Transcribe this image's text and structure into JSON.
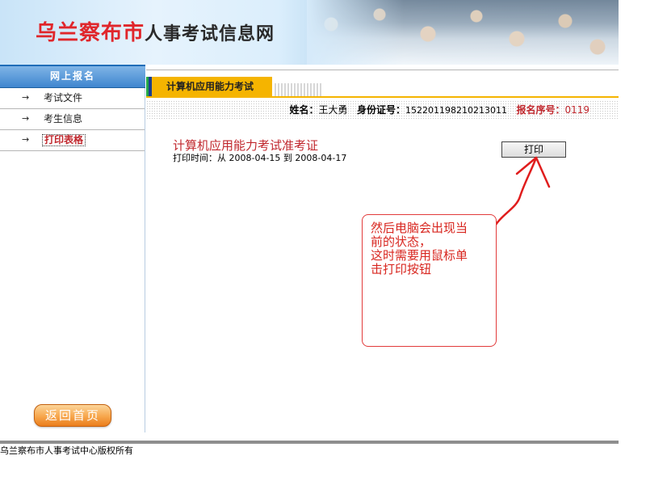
{
  "banner": {
    "city": "乌兰察布市",
    "title_rest": "人事考试信息网"
  },
  "sidebar": {
    "header": "网上报名",
    "items": [
      {
        "arrow": "→",
        "label": "考试文件"
      },
      {
        "arrow": "→",
        "label": "考生信息"
      },
      {
        "arrow": "→",
        "label": "打印表格"
      }
    ],
    "home_button": "返回首页"
  },
  "main": {
    "tab_label": "计算机应用能力考试",
    "info": {
      "name_label": "姓名：",
      "name_value": "王大勇",
      "id_label": "身份证号：",
      "id_value": "152201198210213011",
      "reg_label": "报名序号：",
      "reg_value": "0119"
    },
    "card_title": "计算机应用能力考试准考证",
    "print_time_label": "打印时间：",
    "print_time_value": "从 2008-04-15 到 2008-04-17",
    "print_button": "打印"
  },
  "annotation": {
    "text": "然后电脑会出现当\n前的状态，\n这时需要用鼠标单\n击打印按钮",
    "color": "#d8261f"
  },
  "footer": {
    "copyright": "乌兰察布市人事考试中心版权所有"
  }
}
